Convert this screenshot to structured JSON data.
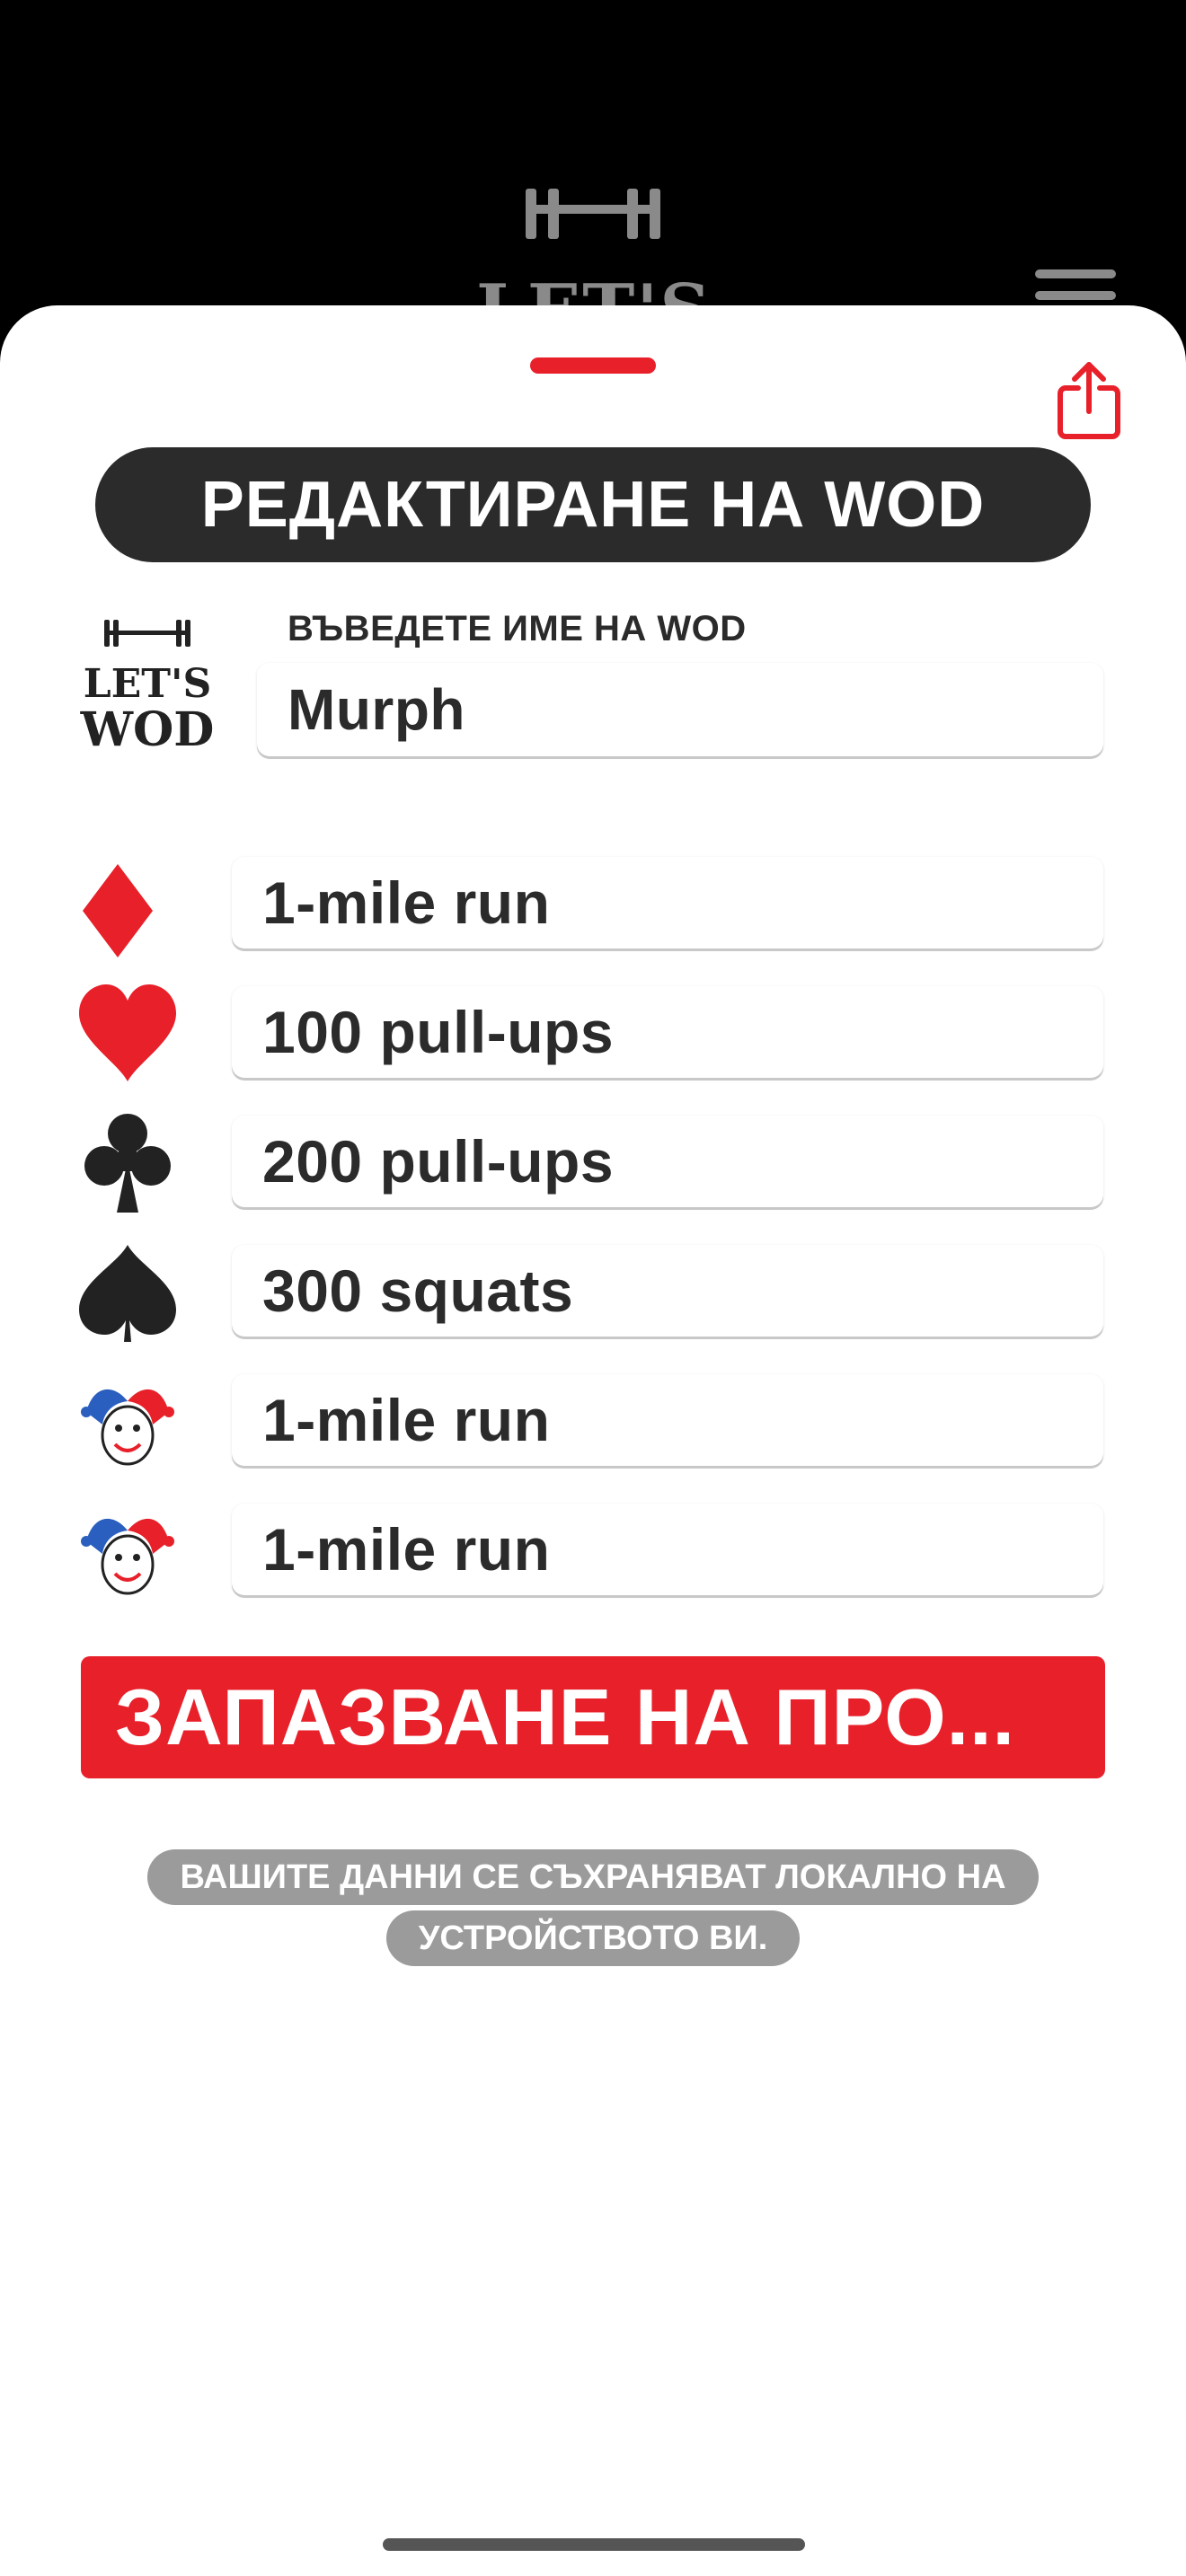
{
  "app": {
    "background_logo_text": "LET'S",
    "accent_color": "#e8202a"
  },
  "sheet": {
    "title": "РЕДАКТИРАНЕ НА WOD",
    "brand_logo_line1": "LET'S",
    "brand_logo_line2": "WOD",
    "name_label": "ВЪВЕДЕТЕ ИМЕ НА WOD",
    "name_value": "Murph",
    "exercises": [
      {
        "icon": "diamond-suit-icon",
        "value": "1-mile run"
      },
      {
        "icon": "heart-suit-icon",
        "value": "100 pull-ups"
      },
      {
        "icon": "club-suit-icon",
        "value": "200 pull-ups"
      },
      {
        "icon": "spade-suit-icon",
        "value": "300 squats"
      },
      {
        "icon": "joker-icon",
        "value": "1-mile run"
      },
      {
        "icon": "joker-icon",
        "value": "1-mile run"
      }
    ],
    "save_button": "ЗАПАЗВАНЕ НА ПРО...",
    "note": "ВАШИТЕ ДАННИ СЕ СЪХРАНЯВАТ ЛОКАЛНО НА УСТРОЙСТВОТО ВИ."
  }
}
